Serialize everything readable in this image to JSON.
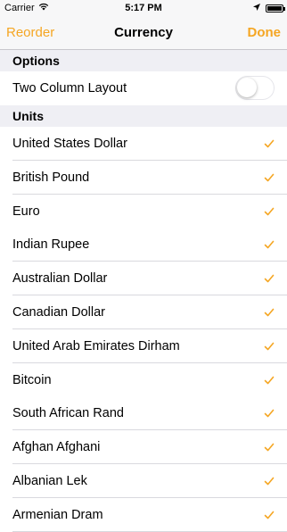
{
  "status_bar": {
    "carrier": "Carrier",
    "time": "5:17 PM",
    "battery_percent_label": "",
    "icons": [
      "wifi-icon",
      "location-arrow-icon",
      "battery-icon"
    ]
  },
  "nav": {
    "left_label": "Reorder",
    "title": "Currency",
    "right_label": "Done",
    "accent_color": "#f5a623"
  },
  "sections": {
    "options": {
      "header": "Options",
      "items": [
        {
          "label": "Two Column Layout",
          "toggle_on": false
        }
      ]
    },
    "units": {
      "header": "Units",
      "items": [
        {
          "label": "United States Dollar",
          "checked": true
        },
        {
          "label": "British Pound",
          "checked": true
        },
        {
          "label": "Euro",
          "checked": true
        },
        {
          "label": "Indian Rupee",
          "checked": true
        },
        {
          "label": "Australian Dollar",
          "checked": true
        },
        {
          "label": "Canadian Dollar",
          "checked": true
        },
        {
          "label": "United Arab Emirates Dirham",
          "checked": true
        },
        {
          "label": "Bitcoin",
          "checked": true
        },
        {
          "label": "South African Rand",
          "checked": true
        },
        {
          "label": "Afghan Afghani",
          "checked": true
        },
        {
          "label": "Albanian Lek",
          "checked": true
        },
        {
          "label": "Armenian Dram",
          "checked": true
        }
      ]
    }
  }
}
